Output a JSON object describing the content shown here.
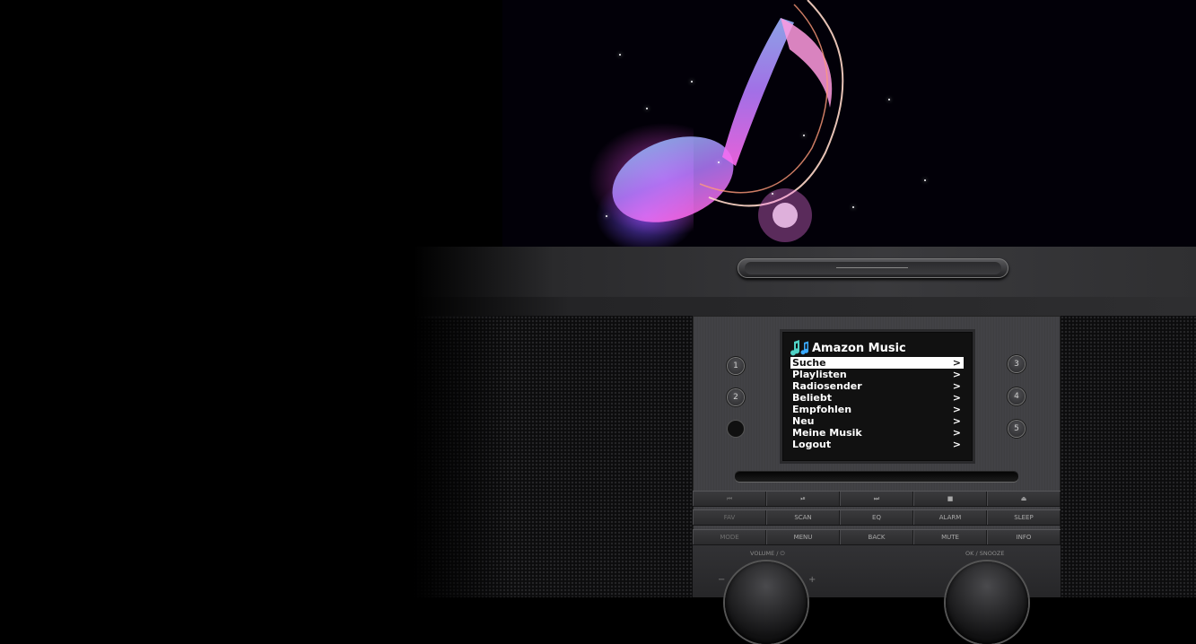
{
  "display": {
    "icon": "music-note-icon",
    "title": "Amazon Music",
    "menu": [
      {
        "label": "Suche",
        "arrow": ">",
        "selected": true
      },
      {
        "label": "Playlisten",
        "arrow": ">"
      },
      {
        "label": "Radiosender",
        "arrow": ">"
      },
      {
        "label": "Beliebt",
        "arrow": ">"
      },
      {
        "label": "Empfohlen",
        "arrow": ">"
      },
      {
        "label": "Neu",
        "arrow": ">"
      },
      {
        "label": "Meine Musik",
        "arrow": ">"
      },
      {
        "label": "Logout",
        "arrow": ">"
      }
    ]
  },
  "presets": {
    "p1": "1",
    "p2": "2",
    "p3": "3",
    "p4": "4",
    "p5": "5"
  },
  "transport": {
    "prev": "⏮",
    "play_pause": "⏯",
    "next": "⏭",
    "stop": "■",
    "eject": "⏏"
  },
  "row2": {
    "fav": "FAV",
    "scan": "SCAN",
    "eq": "EQ",
    "alarm": "ALARM",
    "sleep": "SLEEP"
  },
  "row3": {
    "mode": "MODE",
    "menu": "MENU",
    "back": "BACK",
    "mute": "MUTE",
    "info": "INFO"
  },
  "knobs": {
    "volume_label": "VOLUME / ⏻",
    "ok_label": "OK / SNOOZE",
    "minus": "−",
    "plus": "+"
  },
  "colors": {
    "screen_bg": "#111111",
    "selected_bg": "#ffffff",
    "device": "#3d3d40"
  }
}
